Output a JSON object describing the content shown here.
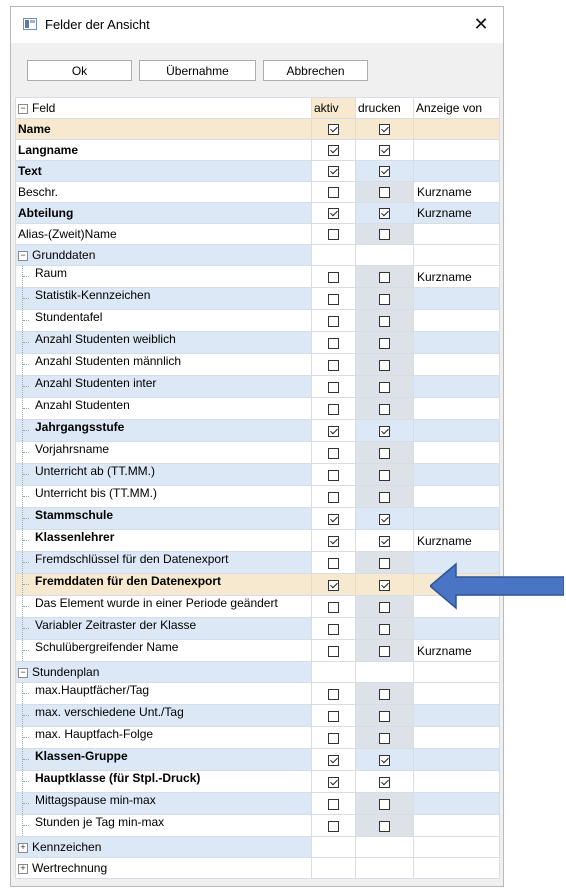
{
  "window": {
    "title": "Felder der Ansicht",
    "close_glyph": "✕"
  },
  "buttons": {
    "ok": "Ok",
    "uebernahme": "Übernahme",
    "abbrechen": "Abbrechen"
  },
  "columns": {
    "feld": "Feld",
    "aktiv": "aktiv",
    "drucken": "drucken",
    "anzeige": "Anzeige von"
  },
  "colors": {
    "highlight_row": "#f6e9cf",
    "blue_row": "#dce8f5",
    "arrow": "#4a74c4"
  },
  "rows": [
    {
      "label": "Name",
      "bold": true,
      "level": 0,
      "aktiv": true,
      "drucken": true,
      "anzeige": "",
      "bg": "highlight"
    },
    {
      "label": "Langname",
      "bold": true,
      "level": 0,
      "aktiv": true,
      "drucken": true,
      "anzeige": "",
      "bg": "white"
    },
    {
      "label": "Text",
      "bold": true,
      "level": 0,
      "aktiv": true,
      "drucken": true,
      "anzeige": "",
      "bg": "blue"
    },
    {
      "label": "Beschr.",
      "bold": false,
      "level": 0,
      "aktiv": false,
      "drucken": false,
      "anzeige": "Kurzname",
      "bg": "white"
    },
    {
      "label": "Abteilung",
      "bold": true,
      "level": 0,
      "aktiv": true,
      "drucken": true,
      "anzeige": "Kurzname",
      "bg": "blue"
    },
    {
      "label": "Alias-(Zweit)Name",
      "bold": false,
      "level": 0,
      "aktiv": false,
      "drucken": false,
      "anzeige": "",
      "bg": "white"
    },
    {
      "label": "Grunddaten",
      "bold": false,
      "level": 0,
      "group": "minus",
      "bg": "blue"
    },
    {
      "label": "Raum",
      "bold": false,
      "level": 1,
      "aktiv": false,
      "drucken": false,
      "anzeige": "Kurzname",
      "bg": "white"
    },
    {
      "label": "Statistik-Kennzeichen",
      "bold": false,
      "level": 1,
      "aktiv": false,
      "drucken": false,
      "anzeige": "",
      "bg": "blue"
    },
    {
      "label": "Stundentafel",
      "bold": false,
      "level": 1,
      "aktiv": false,
      "drucken": false,
      "anzeige": "",
      "bg": "white"
    },
    {
      "label": "Anzahl Studenten weiblich",
      "bold": false,
      "level": 1,
      "aktiv": false,
      "drucken": false,
      "anzeige": "",
      "bg": "blue"
    },
    {
      "label": "Anzahl Studenten männlich",
      "bold": false,
      "level": 1,
      "aktiv": false,
      "drucken": false,
      "anzeige": "",
      "bg": "white"
    },
    {
      "label": "Anzahl Studenten inter",
      "bold": false,
      "level": 1,
      "aktiv": false,
      "drucken": false,
      "anzeige": "",
      "bg": "blue"
    },
    {
      "label": "Anzahl Studenten",
      "bold": false,
      "level": 1,
      "aktiv": false,
      "drucken": false,
      "anzeige": "",
      "bg": "white"
    },
    {
      "label": "Jahrgangsstufe",
      "bold": true,
      "level": 1,
      "aktiv": true,
      "drucken": true,
      "anzeige": "",
      "bg": "blue"
    },
    {
      "label": "Vorjahrsname",
      "bold": false,
      "level": 1,
      "aktiv": false,
      "drucken": false,
      "anzeige": "",
      "bg": "white"
    },
    {
      "label": "Unterricht ab (TT.MM.)",
      "bold": false,
      "level": 1,
      "aktiv": false,
      "drucken": false,
      "anzeige": "",
      "bg": "blue"
    },
    {
      "label": "Unterricht bis (TT.MM.)",
      "bold": false,
      "level": 1,
      "aktiv": false,
      "drucken": false,
      "anzeige": "",
      "bg": "white"
    },
    {
      "label": "Stammschule",
      "bold": true,
      "level": 1,
      "aktiv": true,
      "drucken": true,
      "anzeige": "",
      "bg": "blue"
    },
    {
      "label": "Klassenlehrer",
      "bold": true,
      "level": 1,
      "aktiv": true,
      "drucken": true,
      "anzeige": "Kurzname",
      "bg": "white"
    },
    {
      "label": "Fremdschlüssel für den Datenexport",
      "bold": false,
      "level": 1,
      "aktiv": false,
      "drucken": false,
      "anzeige": "",
      "bg": "blue"
    },
    {
      "label": "Fremddaten für den Datenexport",
      "bold": true,
      "level": 1,
      "aktiv": true,
      "drucken": true,
      "anzeige": "",
      "bg": "highlight"
    },
    {
      "label": "Das Element wurde in einer Periode geändert",
      "bold": false,
      "level": 1,
      "aktiv": false,
      "drucken": false,
      "anzeige": "",
      "bg": "white"
    },
    {
      "label": "Variabler Zeitraster der Klasse",
      "bold": false,
      "level": 1,
      "aktiv": false,
      "drucken": false,
      "anzeige": "",
      "bg": "blue"
    },
    {
      "label": "Schulübergreifender Name",
      "bold": false,
      "level": 1,
      "aktiv": false,
      "drucken": false,
      "anzeige": "Kurzname",
      "bg": "white"
    },
    {
      "label": "Stundenplan",
      "bold": false,
      "level": 0,
      "group": "minus",
      "bg": "blue"
    },
    {
      "label": "max.Hauptfächer/Tag",
      "bold": false,
      "level": 1,
      "aktiv": false,
      "drucken": false,
      "anzeige": "",
      "bg": "white"
    },
    {
      "label": "max. verschiedene Unt./Tag",
      "bold": false,
      "level": 1,
      "aktiv": false,
      "drucken": false,
      "anzeige": "",
      "bg": "blue"
    },
    {
      "label": "max. Hauptfach-Folge",
      "bold": false,
      "level": 1,
      "aktiv": false,
      "drucken": false,
      "anzeige": "",
      "bg": "white"
    },
    {
      "label": "Klassen-Gruppe",
      "bold": true,
      "level": 1,
      "aktiv": true,
      "drucken": true,
      "anzeige": "",
      "bg": "blue"
    },
    {
      "label": "Hauptklasse (für Stpl.-Druck)",
      "bold": true,
      "level": 1,
      "aktiv": true,
      "drucken": true,
      "anzeige": "",
      "bg": "white"
    },
    {
      "label": "Mittagspause min-max",
      "bold": false,
      "level": 1,
      "aktiv": false,
      "drucken": false,
      "anzeige": "",
      "bg": "blue"
    },
    {
      "label": "Stunden je Tag min-max",
      "bold": false,
      "level": 1,
      "aktiv": false,
      "drucken": false,
      "anzeige": "",
      "bg": "white"
    },
    {
      "label": "Kennzeichen",
      "bold": false,
      "level": 0,
      "group": "plus",
      "bg": "blue"
    },
    {
      "label": "Wertrechnung",
      "bold": false,
      "level": 0,
      "group": "plus",
      "bg": "white"
    }
  ]
}
